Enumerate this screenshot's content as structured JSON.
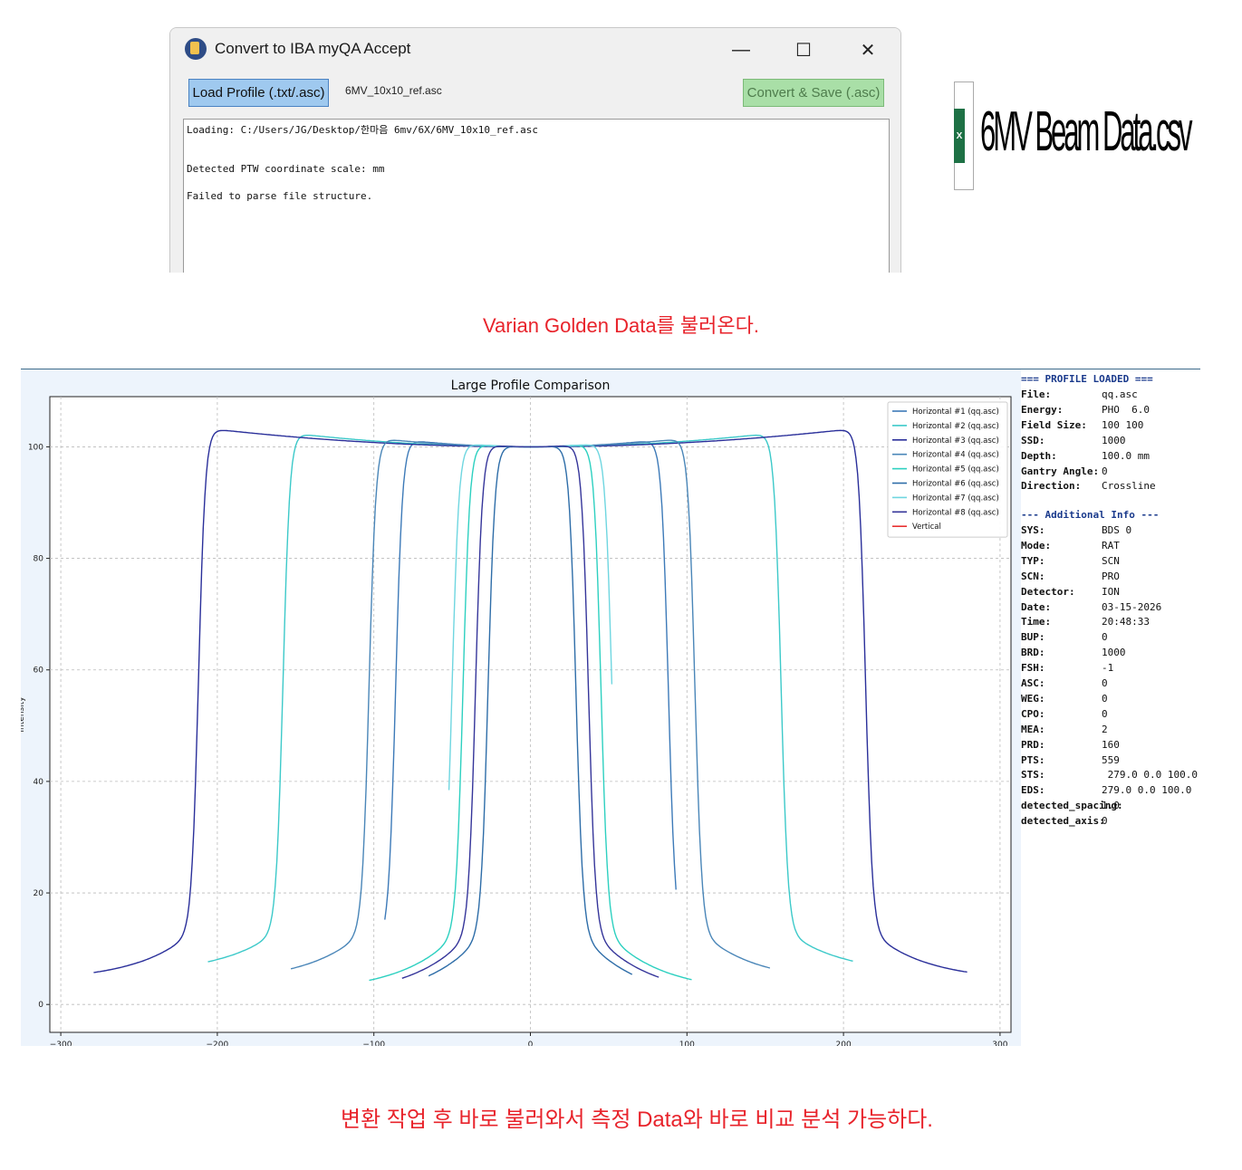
{
  "window": {
    "title": "Convert to IBA myQA Accept",
    "minimize_glyph": "—",
    "maximize_glyph": "☐",
    "close_glyph": "✕",
    "load_button": "Load Profile (.txt/.asc)",
    "loaded_file": "6MV_10x10_ref.asc",
    "convert_button": "Convert & Save (.asc)",
    "log_lines": [
      "Loading: C:/Users/JG/Desktop/한마음 6mv/6X/6MV_10x10_ref.asc",
      "",
      "",
      "Detected PTW coordinate scale: mm",
      "",
      "Failed to parse file structure."
    ]
  },
  "file_icon": {
    "badge": "X",
    "name": "6MV Beam Data.csv"
  },
  "caption_top": "Varian Golden Data를 불러온다.",
  "caption_bottom": "변환 작업 후 바로 불러와서 측정 Data와 바로 비교 분석 가능하다.",
  "info_panel": {
    "header": "=== PROFILE LOADED ===",
    "rows": [
      {
        "k": "File:",
        "v": "qq.asc"
      },
      {
        "k": "Energy:",
        "v": "PHO  6.0"
      },
      {
        "k": "Field Size:",
        "v": "100 100"
      },
      {
        "k": "SSD:",
        "v": "1000"
      },
      {
        "k": "Depth:",
        "v": "100.0 mm"
      },
      {
        "k": "Gantry Angle:",
        "v": "0"
      },
      {
        "k": "Direction:",
        "v": "Crossline"
      }
    ],
    "section2": "--- Additional Info ---",
    "rows2": [
      {
        "k": "SYS:",
        "v": "BDS 0"
      },
      {
        "k": "Mode:",
        "v": "RAT"
      },
      {
        "k": "TYP:",
        "v": "SCN"
      },
      {
        "k": "SCN:",
        "v": "PRO"
      },
      {
        "k": "Detector:",
        "v": "ION"
      },
      {
        "k": "Date:",
        "v": "03-15-2026"
      },
      {
        "k": "Time:",
        "v": "20:48:33"
      },
      {
        "k": "BUP:",
        "v": "0"
      },
      {
        "k": "BRD:",
        "v": "1000"
      },
      {
        "k": "FSH:",
        "v": "-1"
      },
      {
        "k": "ASC:",
        "v": "0"
      },
      {
        "k": "WEG:",
        "v": "0"
      },
      {
        "k": "CPO:",
        "v": "0"
      },
      {
        "k": "MEA:",
        "v": "2"
      },
      {
        "k": "PRD:",
        "v": "160"
      },
      {
        "k": "PTS:",
        "v": "559"
      },
      {
        "k": "STS:",
        "v": " 279.0 0.0 100.0"
      },
      {
        "k": "EDS:",
        "v": "279.0 0.0 100.0"
      },
      {
        "k": "detected_spacing:",
        "v": "1.0"
      },
      {
        "k": "detected_axis:",
        "v": "0"
      }
    ]
  },
  "chart_data": {
    "type": "line",
    "title": "Large Profile Comparison",
    "xlabel": "",
    "ylabel": "Intensity",
    "xlim": [
      -307,
      307
    ],
    "ylim": [
      -5,
      109
    ],
    "xticks": [
      -300,
      -200,
      -100,
      0,
      100,
      200,
      300
    ],
    "yticks": [
      0,
      20,
      40,
      60,
      80,
      100
    ],
    "grid": true,
    "legend_position": "top-right",
    "series": [
      {
        "name": "Horizontal #1 (qq.asc)",
        "color": "#3d7ab8",
        "half_width": 86,
        "edge_right": 88,
        "extent": 93,
        "tail": 0.8
      },
      {
        "name": "Horizontal #2 (qq.asc)",
        "color": "#3cc9c9",
        "half_width": 158,
        "edge_right": 160,
        "extent": 206,
        "tail": 5.5
      },
      {
        "name": "Horizontal #3 (qq.asc)",
        "color": "#2a2f9a",
        "half_width": 212,
        "edge_right": 214,
        "extent": 279,
        "tail": 4.3
      },
      {
        "name": "Horizontal #4 (qq.asc)",
        "color": "#4a86b8",
        "half_width": 103,
        "edge_right": 105,
        "extent": 153,
        "tail": 4.0
      },
      {
        "name": "Horizontal #5 (qq.asc)",
        "color": "#2dd0c0",
        "half_width": 43,
        "edge_right": 45,
        "extent": 103,
        "tail": 2.2
      },
      {
        "name": "Horizontal #6 (qq.asc)",
        "color": "#2e6da8",
        "half_width": 27,
        "edge_right": 29,
        "extent": 65,
        "tail": 0.6
      },
      {
        "name": "Horizontal #7 (qq.asc)",
        "color": "#6fd6e0",
        "half_width": 50,
        "edge_right": 52,
        "extent": 52,
        "tail": 0.9
      },
      {
        "name": "Horizontal #8 (qq.asc)",
        "color": "#35359a",
        "half_width": 35,
        "edge_right": 37,
        "extent": 82,
        "tail": 1.4
      },
      {
        "name": "Vertical",
        "color": "#e83030",
        "half_width": 0,
        "edge_right": 0,
        "extent": 0,
        "tail": 0
      }
    ]
  }
}
